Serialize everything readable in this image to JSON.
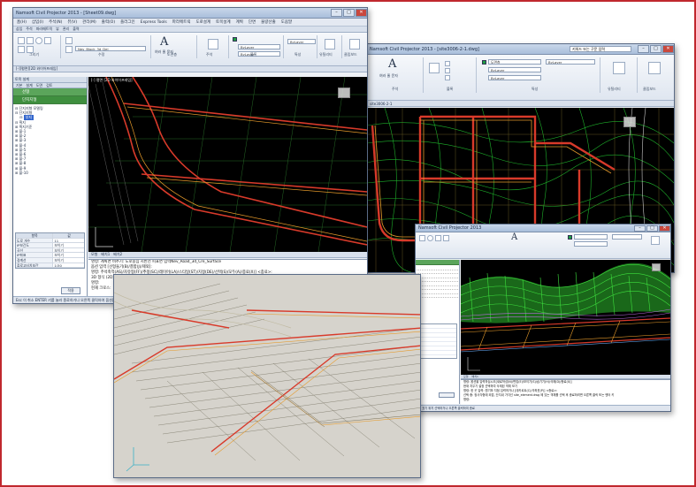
{
  "win1": {
    "title": "Namsoft Civil Projector 2013 - [Sheet09.dwg]",
    "menu": [
      "홈(H)",
      "삽입(I)",
      "주석(N)",
      "뷰(V)",
      "관리(M)",
      "출력(O)",
      "플러그인",
      "Express Tools",
      "파라메트릭",
      "도로설계",
      "토목설계",
      "계획",
      "단면",
      "물량산출",
      "도움말"
    ],
    "quick_tabs": [
      "삽입",
      "주석",
      "파라메트릭",
      "뷰",
      "관리",
      "출력"
    ],
    "ribbon": {
      "text_tool": "여러 줄 문자",
      "layer_combo": "Nev_Block_3d_Del",
      "bylayer": "ByLayer",
      "groups": [
        "그리기",
        "수정",
        "도면층",
        "주석",
        "블록",
        "특성",
        "유틸리티",
        "클립보드"
      ]
    },
    "doc_tabs": [
      "[-][평면][2D 와이어프레임]"
    ],
    "viewport_label": "[-] 평면 [2D 와이어프레임]",
    "panel": {
      "title": "토목 설계",
      "tabs": [
        "기본",
        "설계",
        "도면",
        "검토"
      ],
      "bar_main": "선형",
      "bar_sub": "단지지형",
      "tree": [
        "⊟ 단지지형 모델링",
        "  ⊟ 단지지형",
        "    ⊟ 부지",
        "      ⊟ 획지",
        "        ⊞ 획지기준",
        "        ⊞ 블-1",
        "        ⊞ 블-2",
        "        ⊞ 블-3",
        "        ⊞ 블-4",
        "        ⊞ 블-5",
        "        ⊞ 블-6",
        "        ⊞ 블-7",
        "        ⊞ 블-8",
        "        ⊞ 블-9",
        "        ⊞ 블-10"
      ],
      "tree_selected": "부지",
      "props_head": [
        "항목",
        "값"
      ],
      "props": [
        [
          "도로 개수",
          "11"
        ],
        [
          "IP보간도",
          "보이기"
        ],
        [
          "곡선",
          "보이기"
        ],
        [
          "IP좌표",
          "보이기"
        ],
        [
          "경계선",
          "보이기"
        ],
        [
          "플로고터치보간",
          "1/30"
        ]
      ],
      "apply": "적용"
    },
    "layout_tabs": [
      "모형",
      "배치1",
      "배치2"
    ],
    "command_lines": [
      "명령: 계획면 비추기: 도로중심 지반선   피표면 입력Nev_Road_3d_Cre_Surface",
      "옵션 입력 [선형들기(B)/결합(J)/제외]:",
      "명령: 주석축척(AS)/자유형(FF)/추정(SC)/레이어(LA)/스타일(ST)/지정(DE)/선택(S)/모두(A)/종료(X)] <종료>:",
      "3D 형식 (2D)/와이어프레임(W)/숨김(H)/실제(R)/개념(C)/음영(S)/모서리 음영(E)/회색(G)/스케치(SK)/X선(X)/기타(O)] <3D 와이어프레임>:",
      "명령:",
      "현재 크로스:"
    ],
    "status": "Esc 이 취소 ENTER 키를 눌러 종료하거나 오른쪽 클릭하여 옵션을 봅니다"
  },
  "win2": {
    "title": "Namsoft Civil Projector 2013 - [site3006-2-1.dwg]",
    "search_placeholder": "키워드 또는 구문 입력",
    "ribbon": {
      "text_tool": "여러 줄 문자",
      "bylayer": "ByLayer",
      "layer": "도면층",
      "groups": [
        "주석",
        "블록",
        "특성",
        "유틸리티",
        "클립보드"
      ]
    },
    "doc_tab": "site3006-2-1"
  },
  "win3": {
    "title": "Namsoft Civil Projector 2013",
    "layout_tabs": [
      "모형",
      "배치1"
    ],
    "command_lines": [
      "명령: 옵션을 입력하십시오[새로작성(N)/편집(E)/보이기(S)/숨기기(H)/삭제(D)/종료(X)]",
      "현재 지우기 설정 선택하여 삭제된 객체 보기",
      "명령: 한 곳 입력: 원기하 지점 입력하거나 [데카르트(C)/극좌표(P)] <종료>:",
      "선택 중: 정사각형에 외접, 단지내 가각선 site_element.dwg 에 있는 객체를 선택 후 종료하려면 오른쪽 클릭 또는 엔터 키",
      "명령:"
    ],
    "status": "점 표기 위치 선택하거나 오른쪽 클릭하여 종료"
  },
  "win4": {
    "layout_tabs": [
      "모형",
      "배치1"
    ]
  },
  "colors": {
    "frame_border": "#c0282e",
    "contour_green": "#22c430",
    "road_red": "#d83a2a",
    "road_orange": "#e69a2a",
    "wire_light": "#c4ccb0",
    "viewport_black": "#000000",
    "panel_bar_green": "#5ba55b"
  }
}
